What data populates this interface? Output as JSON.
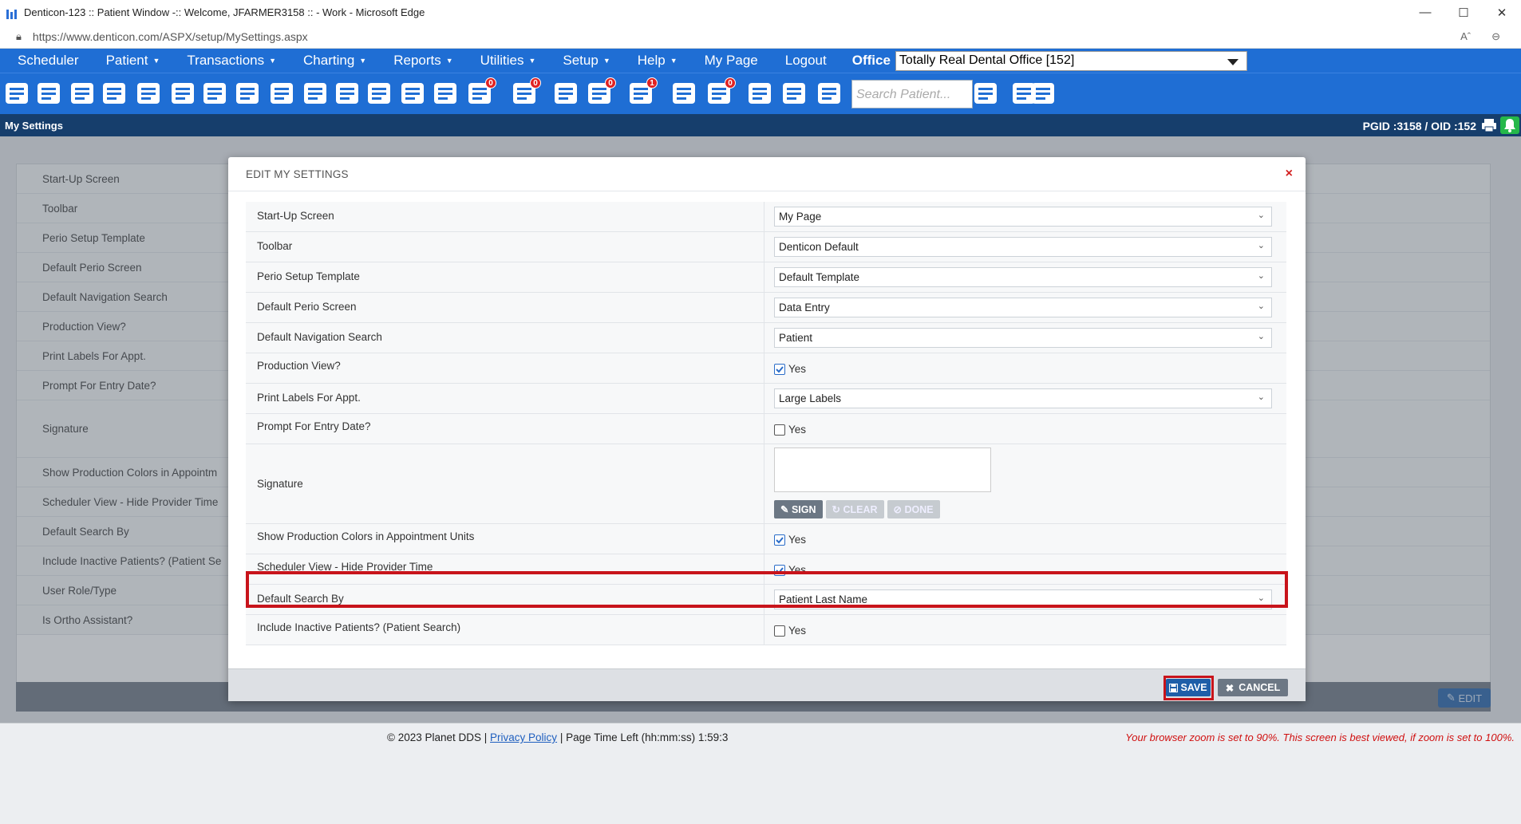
{
  "browser": {
    "title": "Denticon-123 :: Patient Window -:: Welcome, JFARMER3158 :: - Work - Microsoft Edge",
    "url": "https://www.denticon.com/ASPX/setup/MySettings.aspx"
  },
  "menu": {
    "items": [
      {
        "label": "Scheduler",
        "caret": false
      },
      {
        "label": "Patient",
        "caret": true
      },
      {
        "label": "Transactions",
        "caret": true
      },
      {
        "label": "Charting",
        "caret": true
      },
      {
        "label": "Reports",
        "caret": true
      },
      {
        "label": "Utilities",
        "caret": true
      },
      {
        "label": "Setup",
        "caret": true
      },
      {
        "label": "Help",
        "caret": true
      },
      {
        "label": "My Page",
        "caret": false
      },
      {
        "label": "Logout",
        "caret": false
      }
    ],
    "office_label": "Office",
    "office_value": "Totally Real Dental Office [152]"
  },
  "toolbar": {
    "search_placeholder": "Search Patient...",
    "badges": {
      "messages": "0",
      "sms": "0",
      "online": "0",
      "recall": "1",
      "forms": "0"
    }
  },
  "statusbar": {
    "page_title": "My Settings",
    "ids": "PGID :3158  /  OID :152"
  },
  "background_rows": [
    "Start-Up Screen",
    "Toolbar",
    "Perio Setup Template",
    "Default Perio Screen",
    "Default Navigation Search",
    "Production View?",
    "Print Labels For Appt.",
    "Prompt For Entry Date?",
    "Signature",
    "Show Production Colors in Appointm",
    "Scheduler View - Hide Provider Time",
    "Default Search By",
    "Include Inactive Patients? (Patient Se",
    "User Role/Type",
    "Is Ortho Assistant?"
  ],
  "background_edit": "EDIT",
  "modal": {
    "title": "EDIT MY SETTINGS",
    "close": "×",
    "rows": [
      {
        "label": "Start-Up Screen",
        "type": "select",
        "value": "My Page"
      },
      {
        "label": "Toolbar",
        "type": "select",
        "value": "Denticon Default"
      },
      {
        "label": "Perio Setup Template",
        "type": "select",
        "value": "Default Template"
      },
      {
        "label": "Default Perio Screen",
        "type": "select",
        "value": "Data Entry"
      },
      {
        "label": "Default Navigation Search",
        "type": "select",
        "value": "Patient"
      },
      {
        "label": "Production View?",
        "type": "checkbox",
        "value": "Yes",
        "checked": true
      },
      {
        "label": "Print Labels For Appt.",
        "type": "select",
        "value": "Large Labels"
      },
      {
        "label": "Prompt For Entry Date?",
        "type": "checkbox",
        "value": "Yes",
        "checked": false
      },
      {
        "label": "Signature",
        "type": "signature"
      },
      {
        "label": "Show Production Colors in Appointment Units",
        "type": "checkbox",
        "value": "Yes",
        "checked": true
      },
      {
        "label": "Scheduler View - Hide Provider Time",
        "type": "checkbox",
        "value": "Yes",
        "checked": true
      },
      {
        "label": "Default Search By",
        "type": "select",
        "value": "Patient Last Name"
      },
      {
        "label": "Include Inactive Patients? (Patient Search)",
        "type": "checkbox",
        "value": "Yes",
        "checked": false
      }
    ],
    "signature_buttons": {
      "sign": "SIGN",
      "clear": "CLEAR",
      "done": "DONE"
    },
    "save": "SAVE",
    "cancel": "CANCEL"
  },
  "footer": {
    "copyright": "© 2023 Planet DDS | ",
    "privacy": "Privacy Policy",
    "timer": " | Page Time Left (hh:mm:ss) 1:59:3",
    "zoom_note": "Your browser zoom is set to 90%. This screen is best viewed, if zoom is set to 100%."
  },
  "colors": {
    "brand": "#1f6ed4",
    "highlight": "#c8141b",
    "save": "#1e5ea8"
  }
}
